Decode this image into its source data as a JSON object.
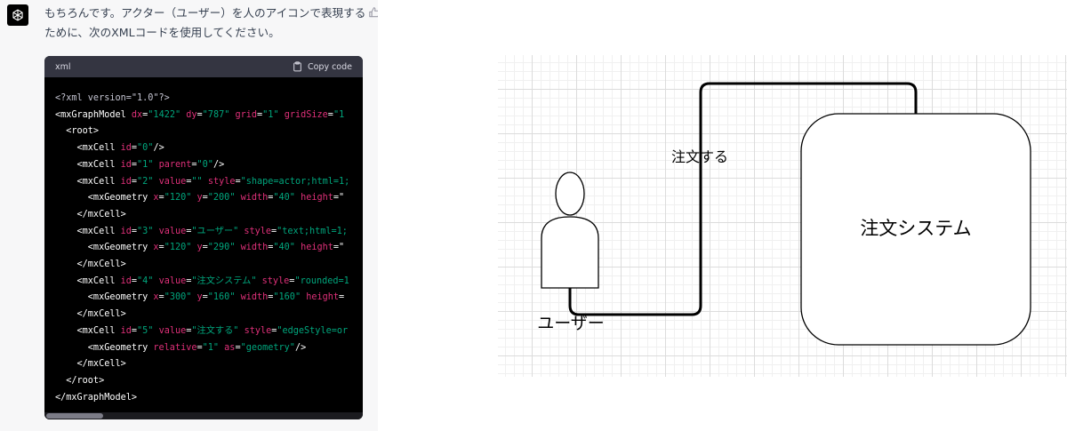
{
  "chat": {
    "message_line1": "もちろんです。アクター（ユーザー）を人のアイコンで表現する",
    "message_line2": "ために、次のXMLコードを使用してください。",
    "code_language": "xml",
    "copy_label": "Copy code",
    "code_lines": [
      [
        {
          "t": "pi",
          "s": "<?xml version=\"1.0\"?>"
        }
      ],
      [
        {
          "t": "tag",
          "s": "<mxGraphModel "
        },
        {
          "t": "attr",
          "s": "dx"
        },
        {
          "t": "tag",
          "s": "="
        },
        {
          "t": "val",
          "s": "\"1422\""
        },
        {
          "t": "tag",
          "s": " "
        },
        {
          "t": "attr",
          "s": "dy"
        },
        {
          "t": "tag",
          "s": "="
        },
        {
          "t": "val",
          "s": "\"787\""
        },
        {
          "t": "tag",
          "s": " "
        },
        {
          "t": "attr",
          "s": "grid"
        },
        {
          "t": "tag",
          "s": "="
        },
        {
          "t": "val",
          "s": "\"1\""
        },
        {
          "t": "tag",
          "s": " "
        },
        {
          "t": "attr",
          "s": "gridSize"
        },
        {
          "t": "tag",
          "s": "="
        },
        {
          "t": "val",
          "s": "\"1"
        }
      ],
      [
        {
          "t": "tag",
          "s": "  <root>"
        }
      ],
      [
        {
          "t": "tag",
          "s": "    <mxCell "
        },
        {
          "t": "attr",
          "s": "id"
        },
        {
          "t": "tag",
          "s": "="
        },
        {
          "t": "val",
          "s": "\"0\""
        },
        {
          "t": "tag",
          "s": "/>"
        }
      ],
      [
        {
          "t": "tag",
          "s": "    <mxCell "
        },
        {
          "t": "attr",
          "s": "id"
        },
        {
          "t": "tag",
          "s": "="
        },
        {
          "t": "val",
          "s": "\"1\""
        },
        {
          "t": "tag",
          "s": " "
        },
        {
          "t": "attr",
          "s": "parent"
        },
        {
          "t": "tag",
          "s": "="
        },
        {
          "t": "val",
          "s": "\"0\""
        },
        {
          "t": "tag",
          "s": "/>"
        }
      ],
      [
        {
          "t": "tag",
          "s": "    <mxCell "
        },
        {
          "t": "attr",
          "s": "id"
        },
        {
          "t": "tag",
          "s": "="
        },
        {
          "t": "val",
          "s": "\"2\""
        },
        {
          "t": "tag",
          "s": " "
        },
        {
          "t": "attr",
          "s": "value"
        },
        {
          "t": "tag",
          "s": "="
        },
        {
          "t": "val",
          "s": "\"\""
        },
        {
          "t": "tag",
          "s": " "
        },
        {
          "t": "attr",
          "s": "style"
        },
        {
          "t": "tag",
          "s": "="
        },
        {
          "t": "val",
          "s": "\"shape=actor;html=1;"
        }
      ],
      [
        {
          "t": "tag",
          "s": "      <mxGeometry "
        },
        {
          "t": "attr",
          "s": "x"
        },
        {
          "t": "tag",
          "s": "="
        },
        {
          "t": "val",
          "s": "\"120\""
        },
        {
          "t": "tag",
          "s": " "
        },
        {
          "t": "attr",
          "s": "y"
        },
        {
          "t": "tag",
          "s": "="
        },
        {
          "t": "val",
          "s": "\"200\""
        },
        {
          "t": "tag",
          "s": " "
        },
        {
          "t": "attr",
          "s": "width"
        },
        {
          "t": "tag",
          "s": "="
        },
        {
          "t": "val",
          "s": "\"40\""
        },
        {
          "t": "tag",
          "s": " "
        },
        {
          "t": "attr",
          "s": "height"
        },
        {
          "t": "tag",
          "s": "=\""
        }
      ],
      [
        {
          "t": "tag",
          "s": "    </mxCell>"
        }
      ],
      [
        {
          "t": "tag",
          "s": "    <mxCell "
        },
        {
          "t": "attr",
          "s": "id"
        },
        {
          "t": "tag",
          "s": "="
        },
        {
          "t": "val",
          "s": "\"3\""
        },
        {
          "t": "tag",
          "s": " "
        },
        {
          "t": "attr",
          "s": "value"
        },
        {
          "t": "tag",
          "s": "="
        },
        {
          "t": "val",
          "s": "\"ユーザー\""
        },
        {
          "t": "tag",
          "s": " "
        },
        {
          "t": "attr",
          "s": "style"
        },
        {
          "t": "tag",
          "s": "="
        },
        {
          "t": "val",
          "s": "\"text;html=1;"
        }
      ],
      [
        {
          "t": "tag",
          "s": "      <mxGeometry "
        },
        {
          "t": "attr",
          "s": "x"
        },
        {
          "t": "tag",
          "s": "="
        },
        {
          "t": "val",
          "s": "\"120\""
        },
        {
          "t": "tag",
          "s": " "
        },
        {
          "t": "attr",
          "s": "y"
        },
        {
          "t": "tag",
          "s": "="
        },
        {
          "t": "val",
          "s": "\"290\""
        },
        {
          "t": "tag",
          "s": " "
        },
        {
          "t": "attr",
          "s": "width"
        },
        {
          "t": "tag",
          "s": "="
        },
        {
          "t": "val",
          "s": "\"40\""
        },
        {
          "t": "tag",
          "s": " "
        },
        {
          "t": "attr",
          "s": "height"
        },
        {
          "t": "tag",
          "s": "=\""
        }
      ],
      [
        {
          "t": "tag",
          "s": "    </mxCell>"
        }
      ],
      [
        {
          "t": "tag",
          "s": "    <mxCell "
        },
        {
          "t": "attr",
          "s": "id"
        },
        {
          "t": "tag",
          "s": "="
        },
        {
          "t": "val",
          "s": "\"4\""
        },
        {
          "t": "tag",
          "s": " "
        },
        {
          "t": "attr",
          "s": "value"
        },
        {
          "t": "tag",
          "s": "="
        },
        {
          "t": "val",
          "s": "\"注文システム\""
        },
        {
          "t": "tag",
          "s": " "
        },
        {
          "t": "attr",
          "s": "style"
        },
        {
          "t": "tag",
          "s": "="
        },
        {
          "t": "val",
          "s": "\"rounded=1"
        }
      ],
      [
        {
          "t": "tag",
          "s": "      <mxGeometry "
        },
        {
          "t": "attr",
          "s": "x"
        },
        {
          "t": "tag",
          "s": "="
        },
        {
          "t": "val",
          "s": "\"300\""
        },
        {
          "t": "tag",
          "s": " "
        },
        {
          "t": "attr",
          "s": "y"
        },
        {
          "t": "tag",
          "s": "="
        },
        {
          "t": "val",
          "s": "\"160\""
        },
        {
          "t": "tag",
          "s": " "
        },
        {
          "t": "attr",
          "s": "width"
        },
        {
          "t": "tag",
          "s": "="
        },
        {
          "t": "val",
          "s": "\"160\""
        },
        {
          "t": "tag",
          "s": " "
        },
        {
          "t": "attr",
          "s": "height"
        },
        {
          "t": "tag",
          "s": "="
        }
      ],
      [
        {
          "t": "tag",
          "s": "    </mxCell>"
        }
      ],
      [
        {
          "t": "tag",
          "s": "    <mxCell "
        },
        {
          "t": "attr",
          "s": "id"
        },
        {
          "t": "tag",
          "s": "="
        },
        {
          "t": "val",
          "s": "\"5\""
        },
        {
          "t": "tag",
          "s": " "
        },
        {
          "t": "attr",
          "s": "value"
        },
        {
          "t": "tag",
          "s": "="
        },
        {
          "t": "val",
          "s": "\"注文する\""
        },
        {
          "t": "tag",
          "s": " "
        },
        {
          "t": "attr",
          "s": "style"
        },
        {
          "t": "tag",
          "s": "="
        },
        {
          "t": "val",
          "s": "\"edgeStyle=or"
        }
      ],
      [
        {
          "t": "tag",
          "s": "      <mxGeometry "
        },
        {
          "t": "attr",
          "s": "relative"
        },
        {
          "t": "tag",
          "s": "="
        },
        {
          "t": "val",
          "s": "\"1\""
        },
        {
          "t": "tag",
          "s": " "
        },
        {
          "t": "attr",
          "s": "as"
        },
        {
          "t": "tag",
          "s": "="
        },
        {
          "t": "val",
          "s": "\"geometry\""
        },
        {
          "t": "tag",
          "s": "/>"
        }
      ],
      [
        {
          "t": "tag",
          "s": "    </mxCell>"
        }
      ],
      [
        {
          "t": "tag",
          "s": "  </root>"
        }
      ],
      [
        {
          "t": "tag",
          "s": "</mxGraphModel>"
        }
      ]
    ]
  },
  "diagram": {
    "actor_label": "ユーザー",
    "edge_label": "注文する",
    "system_label": "注文システム"
  },
  "colors": {
    "code_bg": "#000000",
    "code_header_bg": "#343541",
    "token_attr": "#df3079",
    "token_value": "#00a67d",
    "grid_line": "#dcdcdc"
  },
  "icons": {
    "avatar": "openai-logo-icon",
    "feedback": "thumbs-up-icon",
    "copy": "clipboard-icon"
  }
}
